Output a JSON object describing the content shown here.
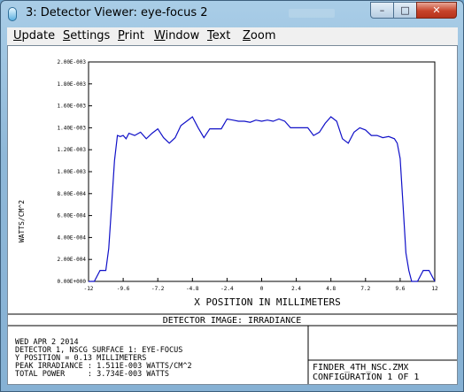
{
  "window": {
    "title": "3: Detector Viewer: eye-focus 2",
    "buttons": {
      "minimize": "–",
      "maximize": "□",
      "close": "✕"
    }
  },
  "menu": [
    "Update",
    "Settings",
    "Print",
    "Window",
    "Text",
    "Zoom"
  ],
  "chart_data": {
    "type": "line",
    "xlabel": "X POSITION IN MILLIMETERS",
    "ylabel": "WATTS/CM^2",
    "xlim": [
      -12,
      12
    ],
    "ylim": [
      0,
      0.002
    ],
    "x_ticks": [
      "-12",
      "-9.6",
      "-7.2",
      "-4.8",
      "-2.4",
      "0",
      "2.4",
      "4.8",
      "7.2",
      "9.6",
      "12"
    ],
    "y_ticks": [
      "0.00E+000",
      "2.00E-004",
      "4.00E-004",
      "6.00E-004",
      "8.00E-004",
      "1.00E-003",
      "1.20E-003",
      "1.40E-003",
      "1.60E-003",
      "1.80E-003",
      "2.00E-003"
    ],
    "color": "#1010c8",
    "series": [
      {
        "x": [
          -12,
          -11.6,
          -11.2,
          -10.8,
          -10.6,
          -10.4,
          -10.2,
          -10.0,
          -9.8,
          -9.6,
          -9.4,
          -9.2,
          -8.8,
          -8.4,
          -8.0,
          -7.6,
          -7.2,
          -6.8,
          -6.4,
          -6.0,
          -5.6,
          -5.2,
          -4.8,
          -4.4,
          -4.0,
          -3.6,
          -3.2,
          -2.8,
          -2.4,
          -2.0,
          -1.6,
          -1.2,
          -0.8,
          -0.4,
          0,
          0.4,
          0.8,
          1.2,
          1.6,
          2.0,
          2.4,
          2.8,
          3.2,
          3.6,
          4.0,
          4.4,
          4.8,
          5.2,
          5.6,
          6.0,
          6.4,
          6.8,
          7.2,
          7.6,
          8.0,
          8.4,
          8.8,
          9.2,
          9.4,
          9.6,
          9.8,
          10.0,
          10.2,
          10.4,
          10.6,
          10.8,
          11.2,
          11.6,
          12
        ],
        "y": [
          0.0,
          0.0,
          0.0001,
          0.0001,
          0.0003,
          0.0007,
          0.0011,
          0.00133,
          0.00132,
          0.00133,
          0.0013,
          0.00135,
          0.00133,
          0.00136,
          0.0013,
          0.00135,
          0.00139,
          0.00131,
          0.00126,
          0.00131,
          0.00142,
          0.00146,
          0.0015,
          0.0014,
          0.00131,
          0.00139,
          0.00139,
          0.00139,
          0.00148,
          0.00147,
          0.00146,
          0.00146,
          0.00145,
          0.00147,
          0.00146,
          0.00147,
          0.00146,
          0.00148,
          0.00146,
          0.0014,
          0.0014,
          0.0014,
          0.0014,
          0.00133,
          0.00136,
          0.00144,
          0.0015,
          0.00146,
          0.0013,
          0.00126,
          0.00136,
          0.0014,
          0.00138,
          0.00133,
          0.00133,
          0.00131,
          0.00132,
          0.0013,
          0.00126,
          0.00112,
          0.00069,
          0.00026,
          0.0001,
          0.0,
          0.0,
          0.0,
          0.0001,
          0.0001,
          0.0
        ]
      }
    ]
  },
  "plot_title": "DETECTOR IMAGE: IRRADIANCE",
  "info_lines": [
    "WED APR 2 2014",
    "DETECTOR 1, NSCG SURFACE 1: EYE-FOCUS",
    "Y POSITION = 0.13 MILLIMETERS",
    "PEAK IRRADIANCE : 1.511E-003 WATTS/CM^2",
    "TOTAL POWER     : 3.734E-003 WATTS"
  ],
  "file_lines": [
    "FINDER_4TH_NSC.ZMX",
    "CONFIGURATION 1 OF 1"
  ]
}
